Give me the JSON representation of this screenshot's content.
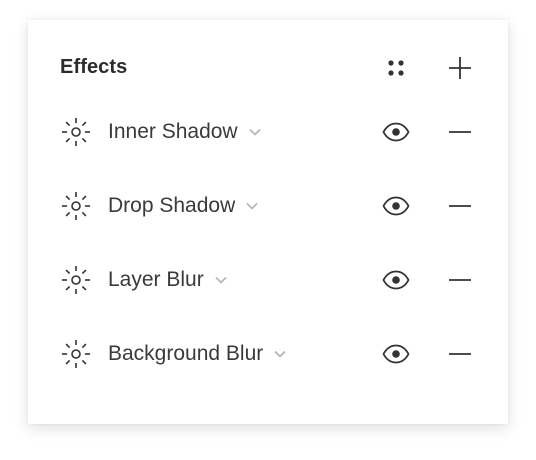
{
  "panel": {
    "title": "Effects",
    "styles_icon": "styles-grid-icon",
    "add_icon": "plus-icon"
  },
  "effects": [
    {
      "type": "Inner Shadow",
      "icon": "effect-sun-icon",
      "visible": true
    },
    {
      "type": "Drop Shadow",
      "icon": "effect-sun-icon",
      "visible": true
    },
    {
      "type": "Layer Blur",
      "icon": "effect-sun-icon",
      "visible": true
    },
    {
      "type": "Background Blur",
      "icon": "effect-sun-icon",
      "visible": true
    }
  ],
  "colors": {
    "text": "#2c2c2c",
    "icon": "#333333",
    "chevron": "#b3b3b3"
  }
}
